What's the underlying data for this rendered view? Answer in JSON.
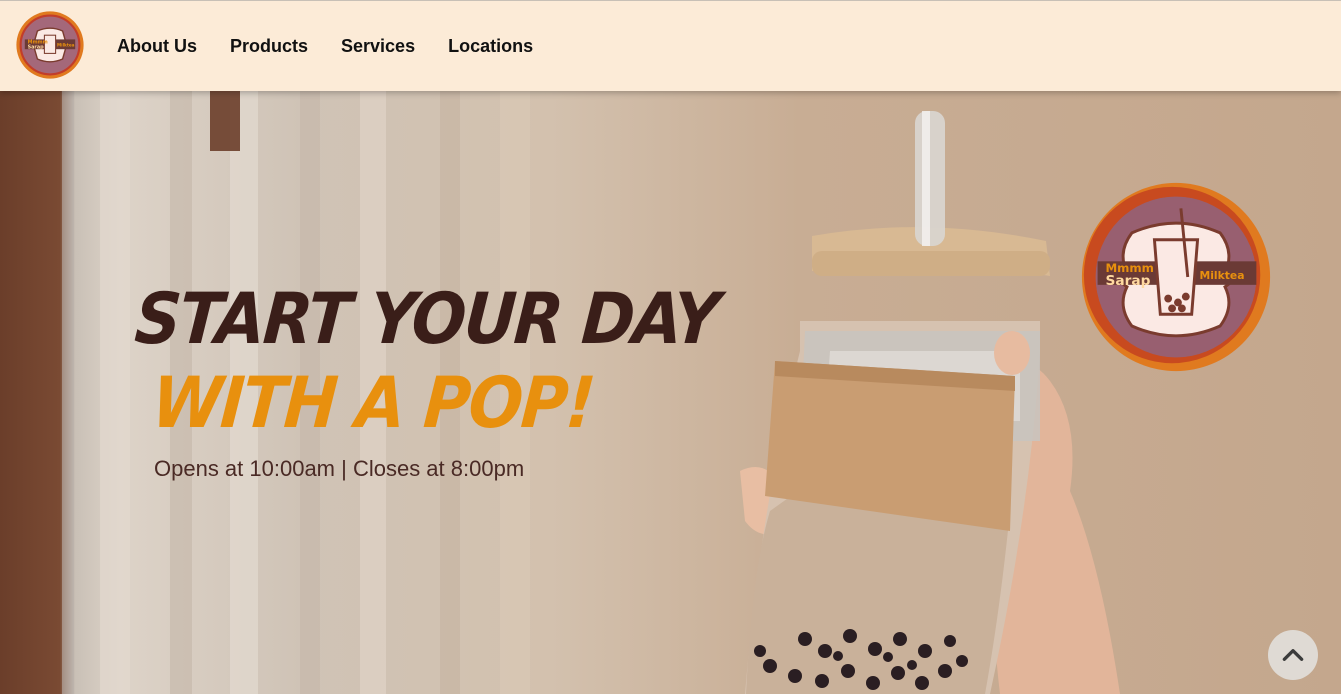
{
  "brand": {
    "logo_text_line1": "Mmmm",
    "logo_text_line2": "Sarap",
    "logo_text_right": "Milktea",
    "logo_icon": "milktea-cup-logo"
  },
  "nav": {
    "items": [
      {
        "label": "About Us"
      },
      {
        "label": "Products"
      },
      {
        "label": "Services"
      },
      {
        "label": "Locations"
      }
    ]
  },
  "hero": {
    "title_line1": "START YOUR DAY",
    "title_line2": "WITH A POP!",
    "hours": "Opens at 10:00am | Closes at 8:00pm",
    "image": "hand-holding-milk-tea-jar"
  },
  "scroll_top": {
    "icon": "chevron-up-icon"
  },
  "colors": {
    "nav_bg": "#fcebd7",
    "title_dark": "#3a1e19",
    "title_accent": "#e8900e",
    "hours_text": "#4a2a25",
    "logo_orange": "#e07a1f",
    "logo_ring": "#8a4a5a"
  }
}
